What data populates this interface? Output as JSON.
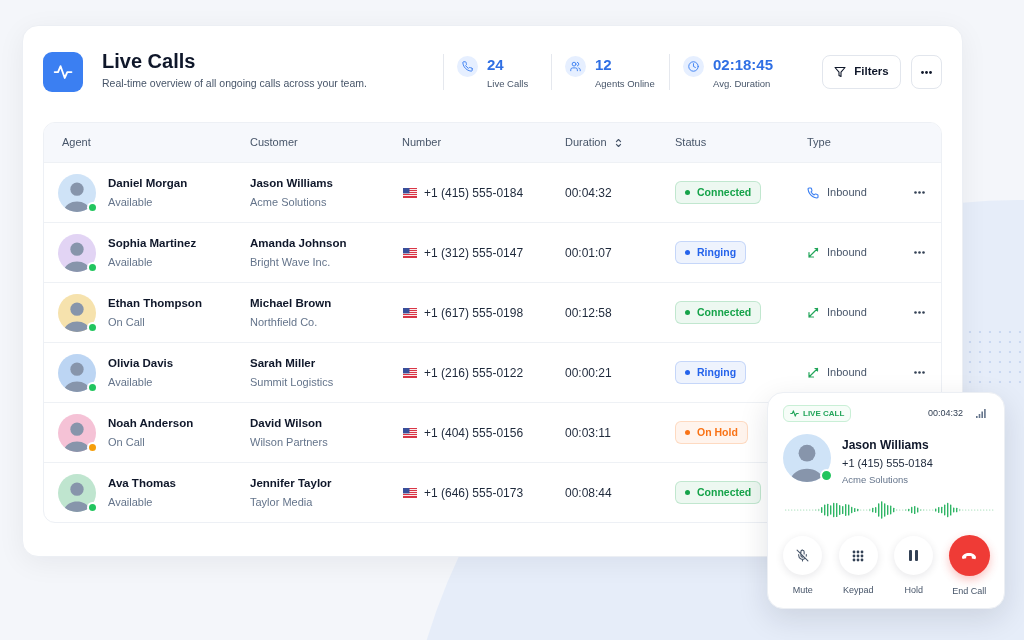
{
  "header": {
    "title": "Live Calls",
    "subtitle": "Real-time overview of all ongoing calls across your team.",
    "stats": [
      {
        "kind": "phone",
        "value": "24",
        "label": "Live Calls"
      },
      {
        "kind": "users",
        "value": "12",
        "label": "Agents Online"
      },
      {
        "kind": "clock",
        "value": "02:18:45",
        "label": "Avg. Duration"
      }
    ],
    "buttons": [
      {
        "kind": "filter",
        "label": "Filters"
      },
      {
        "kind": "more"
      }
    ]
  },
  "table": {
    "columns": [
      {
        "label": "Agent",
        "sortable": false
      },
      {
        "label": "Customer",
        "sortable": false
      },
      {
        "label": "Number",
        "sortable": false
      },
      {
        "label": "Duration",
        "sortable": true
      },
      {
        "label": "Status",
        "sortable": false
      },
      {
        "label": "Type",
        "sortable": false
      }
    ],
    "rows": [
      {
        "agent": {
          "name": "Daniel Morgan",
          "state": "Available",
          "color": "#22c55e"
        },
        "customer": {
          "name": "Jason Williams",
          "company": "Acme Solutions"
        },
        "number": "+1 (415) 555-0184",
        "duration": "00:04:32",
        "status": {
          "label": "Connected",
          "color": "#16a34a"
        },
        "type": {
          "kind": "phone",
          "label": "Inbound"
        },
        "row_menu": true
      },
      {
        "agent": {
          "name": "Sophia Martinez",
          "state": "Available",
          "color": "#22c55e"
        },
        "customer": {
          "name": "Amanda Johnson",
          "company": "Bright Wave Inc."
        },
        "number": "+1 (312) 555-0147",
        "duration": "00:01:07",
        "status": {
          "label": "Ringing",
          "color": "#2563eb"
        },
        "type": {
          "kind": "arrow",
          "label": "Inbound"
        },
        "row_menu": true
      },
      {
        "agent": {
          "name": "Ethan Thompson",
          "state": "On Call",
          "color": "#22c55e"
        },
        "customer": {
          "name": "Michael Brown",
          "company": "Northfield Co."
        },
        "number": "+1 (617) 555-0198",
        "duration": "00:12:58",
        "status": {
          "label": "Connected",
          "color": "#16a34a"
        },
        "type": {
          "kind": "arrow",
          "label": "Inbound"
        },
        "row_menu": true
      },
      {
        "agent": {
          "name": "Olivia Davis",
          "state": "Available",
          "color": "#22c55e"
        },
        "customer": {
          "name": "Sarah Miller",
          "company": "Summit Logistics"
        },
        "number": "+1 (216) 555-0122",
        "duration": "00:00:21",
        "status": {
          "label": "Ringing",
          "color": "#2563eb"
        },
        "type": {
          "kind": "arrow",
          "label": "Inbound"
        },
        "row_menu": true
      },
      {
        "agent": {
          "name": "Noah Anderson",
          "state": "On Call",
          "color": "#f59e0b"
        },
        "customer": {
          "name": "David Wilson",
          "company": "Wilson Partners"
        },
        "number": "+1 (404) 555-0156",
        "duration": "00:03:11",
        "status": {
          "label": "On Hold",
          "color": "#f97316"
        }
      },
      {
        "agent": {
          "name": "Ava Thomas",
          "state": "Available",
          "color": "#22c55e"
        },
        "customer": {
          "name": "Jennifer Taylor",
          "company": "Taylor Media"
        },
        "number": "+1 (646) 555-0173",
        "duration": "00:08:44",
        "status": {
          "label": "Connected",
          "color": "#16a34a"
        }
      }
    ]
  },
  "call_card": {
    "badge": "LIVE CALL",
    "timer": "00:04:32",
    "caller": {
      "name": "Jason Williams",
      "number": "+1 (415) 555-0184",
      "company": "Acme Solutions",
      "color": "#22c55e"
    },
    "controls": [
      {
        "kind": "mute",
        "label": "Mute"
      },
      {
        "kind": "keypad",
        "label": "Keypad"
      },
      {
        "kind": "hold",
        "label": "Hold"
      },
      {
        "kind": "end",
        "label": "End Call"
      }
    ]
  }
}
